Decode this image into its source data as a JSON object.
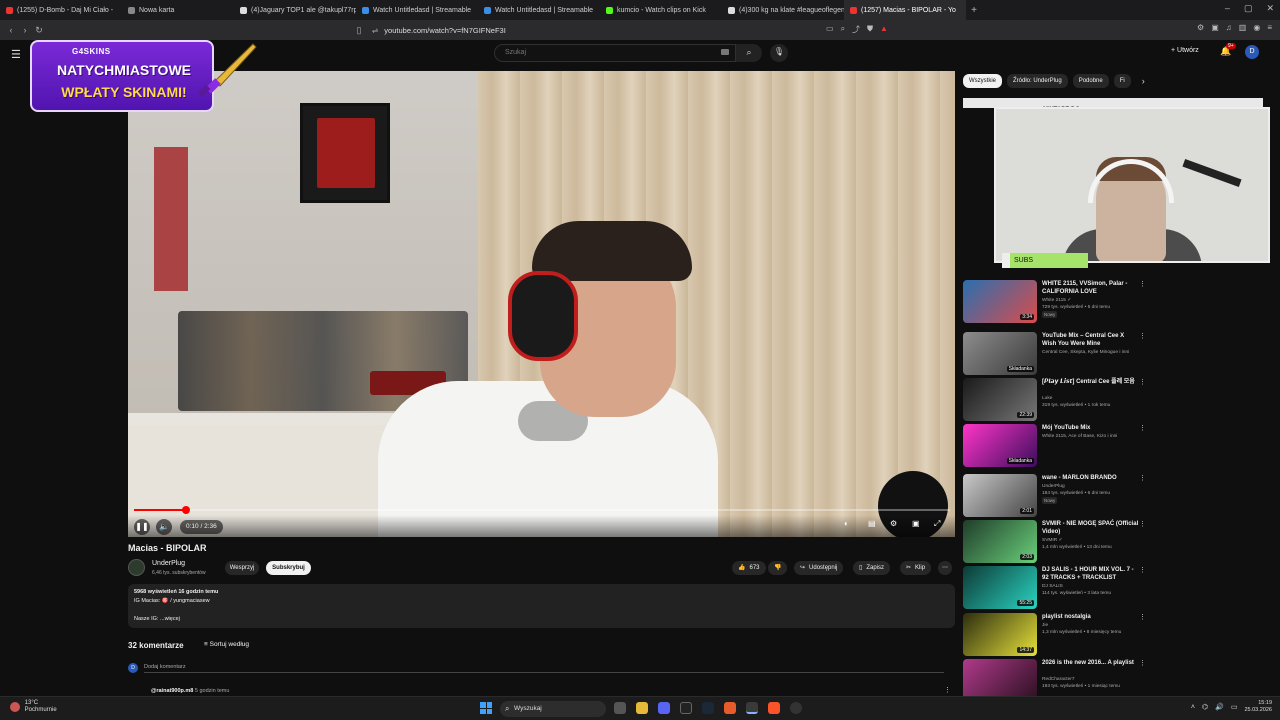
{
  "browser": {
    "tabs": [
      {
        "title": "(1255) D-Bomb - Daj Mi Ciało -",
        "color": "#e33"
      },
      {
        "title": "Nowa karta",
        "color": "#888"
      },
      {
        "title": "(4)Jaguary TOP1 ale @takupl77rp pi",
        "color": "#ddd"
      },
      {
        "title": "Watch Untitledasd | Streamable",
        "color": "#3a8ee6"
      },
      {
        "title": "Watch Untitledasd | Streamable",
        "color": "#3a8ee6"
      },
      {
        "title": "kumcio - Watch clips on Kick",
        "color": "#53fc18"
      },
      {
        "title": "(4)300 kg na klate #leagueoflegends",
        "color": "#ddd"
      },
      {
        "title": "(1257) Macias - BIPOLAR - Yo",
        "color": "#e33",
        "active": true
      }
    ],
    "new_tab": "+",
    "url": "youtube.com/watch?v=fN7GIFNeF3I",
    "window_controls": [
      "–",
      "▢",
      "✕"
    ]
  },
  "youtube": {
    "search_placeholder": "Szukaj",
    "create_label": "+ Utwórz",
    "notifications_count": "9+",
    "avatar_letter": "D"
  },
  "promo": {
    "logo": "G4SKINS",
    "line1": "NATYCHMIASTOWE",
    "line2": "WPŁATY SKINAMI!"
  },
  "player": {
    "time": "0:10 / 2:36",
    "progress_fraction": 0.064
  },
  "video": {
    "title": "Macias - BIPOLAR",
    "channel": "UnderPlug",
    "subscribers": "6,46 tys. subskrybentów",
    "join_label": "Wesprzyj",
    "subscribe_label": "Subskrybuj",
    "likes": "673",
    "share_label": "Udostępnij",
    "save_label": "Zapisz",
    "clip_label": "Klip",
    "description": {
      "views_time": "5968 wyświetleń  16 godzin temu",
      "line2": "IG Macias: 🎯 / yungmaciasew",
      "line3": "Nasze IG: ...więcej"
    }
  },
  "comments": {
    "header": "32 komentarze",
    "sort_label": "Sortuj według",
    "add_placeholder": "Dodaj komentarz",
    "avatar_letter": "D",
    "first_author": "@rainat900p.m8",
    "first_time": "5 godzin temu"
  },
  "chips": [
    "Wszystkie",
    "Źródło: UnderPlug",
    "Podobne",
    "Fi"
  ],
  "overlay": {
    "cam_header": "MIXTAPE DO",
    "subs_label": "SUBS"
  },
  "recommendations": [
    {
      "title": "WHITE 2115, VVSimon, Palar - CALIFORNIA LOVE",
      "meta": [
        "White 2115 ✓",
        "729 tys. wyświetleń • 5 dni temu"
      ],
      "badge": "Nowy",
      "duration": "3:34",
      "colors": [
        "#2a6fb0",
        "#d94c4c"
      ]
    },
    {
      "title": "YouTube Mix – Central Cee X Wish You Were Mine",
      "meta": [
        "Central Cee, Skepta, Kylie Minogue i inni"
      ],
      "duration": "Składanka",
      "colors": [
        "#8d8d8d",
        "#3a3a3a"
      ]
    },
    {
      "title": "[𝙋𝙡𝙖𝙮 𝙇𝙞𝙨𝙩] Central Cee 플레 모음",
      "meta": [
        "Luke",
        "319 tys. wyświetleń • 1 rok temu"
      ],
      "duration": "22:39",
      "colors": [
        "#1a1a1a",
        "#777"
      ]
    },
    {
      "title": "Mój YouTube Mix",
      "meta": [
        "White 2115, Ace of Base, Kizo i inni"
      ],
      "duration": "Składanka",
      "colors": [
        "#ff35c8",
        "#3b0d5c"
      ]
    },
    {
      "title": "wane - MARLON BRANDO",
      "meta": [
        "UnderPlug",
        "184 tys. wyświetleń • 6 dni temu"
      ],
      "badge": "Nowy",
      "duration": "2:01",
      "colors": [
        "#c9c9c9",
        "#444"
      ]
    },
    {
      "title": "SVMIR - NIE MOGĘ SPAĆ (Official Video)",
      "meta": [
        "SVMIR ✓",
        "1,4 mln wyświetleń • 13 dni temu"
      ],
      "duration": "2:03",
      "colors": [
        "#1f3d2a",
        "#6ad07a"
      ]
    },
    {
      "title": "DJ SALIS - 1 HOUR MIX VOL. 7 - 92 TRACKS + TRACKLIST",
      "meta": [
        "DJ SALIS",
        "114 tys. wyświetleń • 3 lata temu"
      ],
      "duration": "55:25",
      "colors": [
        "#0d3a36",
        "#2ad3c0"
      ]
    },
    {
      "title": "playlist nostalgia",
      "meta": [
        "Jie",
        "1,3 mln wyświetleń • 8 miesięcy temu"
      ],
      "duration": "14:37",
      "colors": [
        "#2d2d10",
        "#e6e23a"
      ]
    },
    {
      "title": "2026 is the new 2016... A playlist",
      "meta": [
        "RedCharacter7",
        "193 tys. wyświetleń • 1 miesiąc temu"
      ],
      "duration": "",
      "colors": [
        "#b03a8a",
        "#2a1020"
      ]
    }
  ],
  "taskbar": {
    "weather_temp": "13°C",
    "weather_desc": "Pochmurnie",
    "search_label": "Wyszukaj",
    "time": "15:19",
    "date": "25.03.2026"
  }
}
